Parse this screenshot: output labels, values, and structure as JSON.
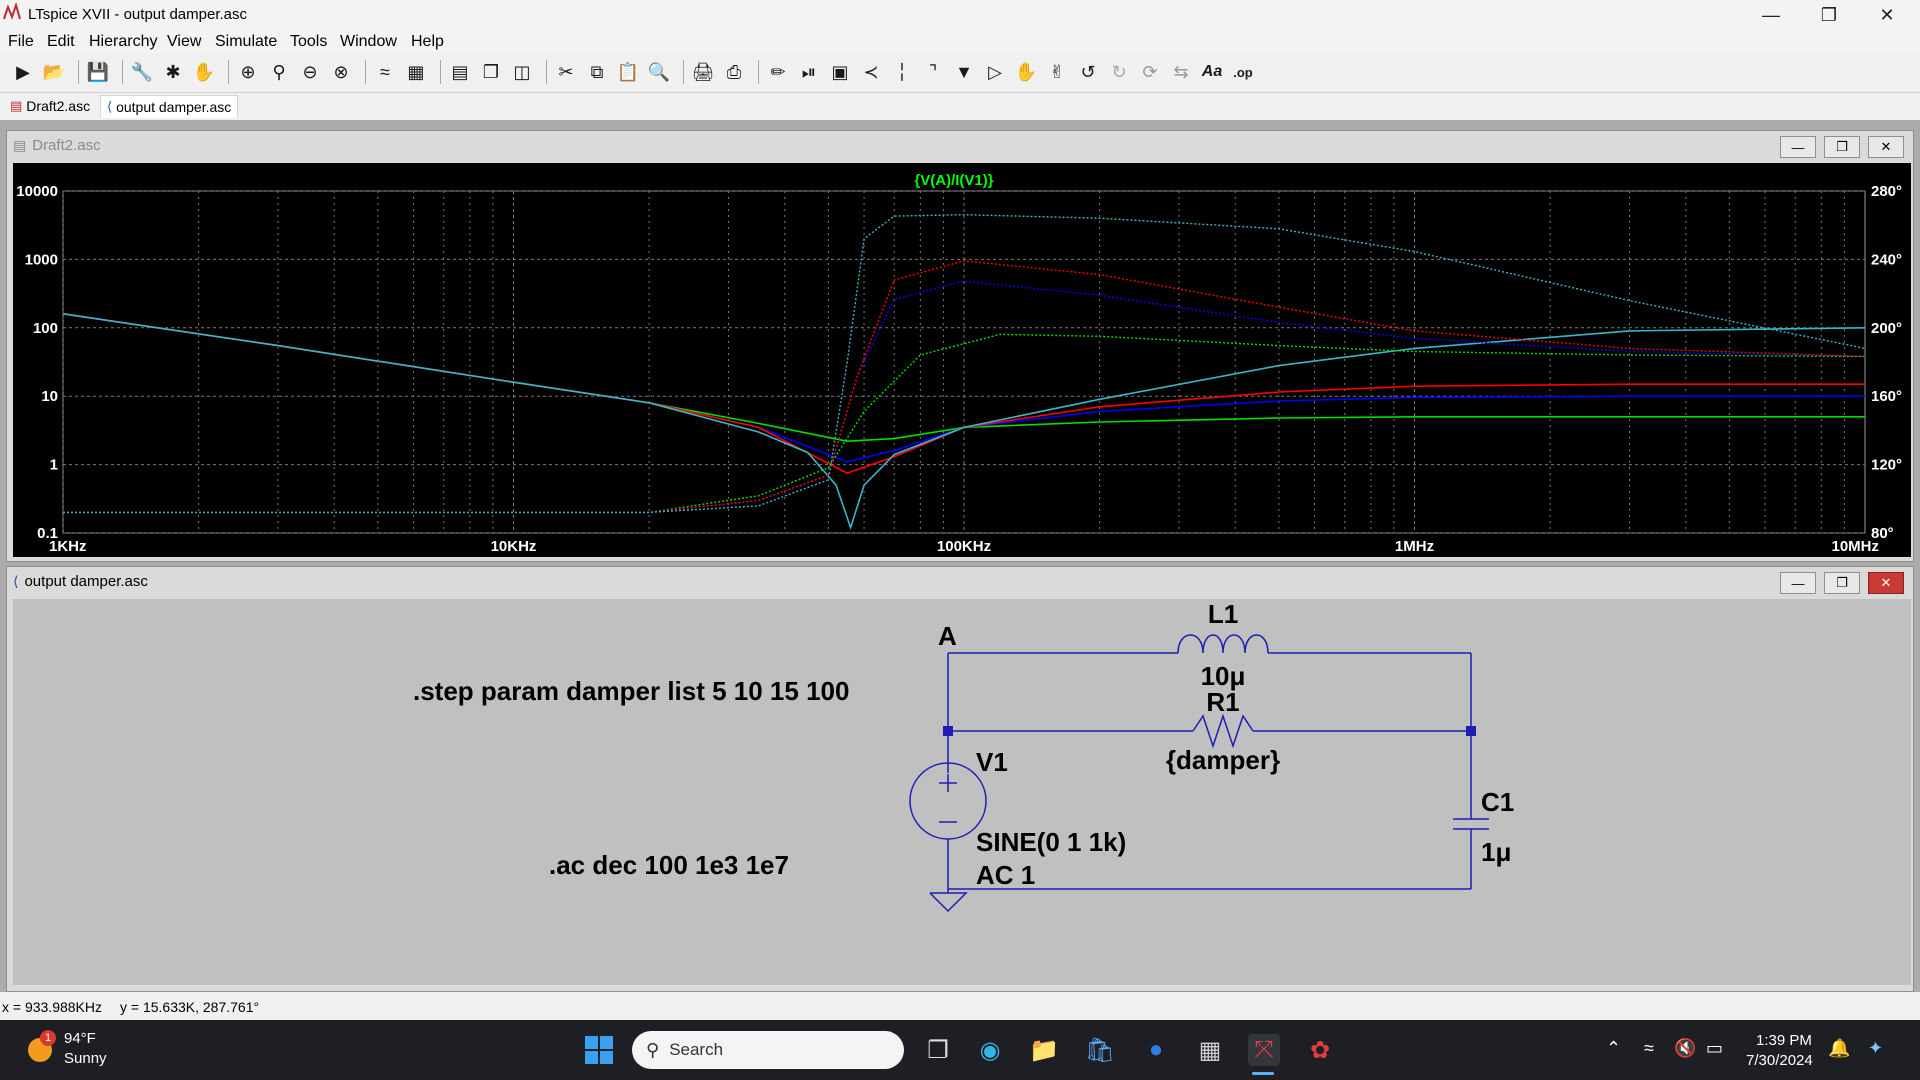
{
  "window": {
    "title": "LTspice XVII - output damper.asc",
    "minimize_icon": "minimize-icon",
    "maximize_icon": "restore-icon",
    "close_icon": "close-icon"
  },
  "menu": [
    "File",
    "Edit",
    "Hierarchy",
    "View",
    "Simulate",
    "Tools",
    "Window",
    "Help"
  ],
  "toolbar": {
    "icons": [
      "run-icon",
      "open-icon",
      "save-icon",
      "control-panel-icon",
      "halt-icon",
      "pan-icon",
      "zoom-in-icon",
      "zoom-area-icon",
      "zoom-out-icon",
      "zoom-fit-icon",
      "autorange-icon",
      "grid-icon",
      "tile-horizontal-icon",
      "cascade-icon",
      "tile-vertical-icon",
      "cut-icon",
      "copy-icon",
      "paste-icon",
      "find-icon",
      "print-icon",
      "print-setup-icon",
      "draw-wire-icon",
      "ground-icon",
      "label-net-icon",
      "resistor-icon",
      "capacitor-icon",
      "inductor-icon",
      "diode-icon",
      "component-icon",
      "move-icon",
      "drag-icon",
      "undo-icon",
      "redo-icon",
      "rotate-icon",
      "mirror-icon",
      "text-icon",
      "spice-directive-icon"
    ],
    "text_button": "Aa",
    "op_button": ".op"
  },
  "tabs": [
    {
      "label": "Draft2.asc",
      "icon": "waveform-icon",
      "active": false
    },
    {
      "label": "output damper.asc",
      "icon": "schematic-icon",
      "active": true
    }
  ],
  "plot_window": {
    "title": "Draft2.asc",
    "trace_expression": "{V(A)/I(V1)}",
    "trace_color": "#00ff00"
  },
  "chart_data": {
    "type": "line",
    "title": "{V(A)/I(V1)}",
    "xlabel": "",
    "ylabel": "",
    "x_scale": "log",
    "y_scale": "log",
    "xlim": [
      1000,
      10000000
    ],
    "ylim": [
      0.1,
      10000
    ],
    "y2lim": [
      80,
      280
    ],
    "x_tick_labels": [
      "1KHz",
      "10KHz",
      "100KHz",
      "1MHz",
      "10MHz"
    ],
    "y_tick_labels": [
      "10000",
      "1000",
      "100",
      "10",
      "1",
      "0.1"
    ],
    "y2_tick_labels": [
      "280°",
      "240°",
      "200°",
      "160°",
      "120°",
      "80°"
    ],
    "grid": true,
    "series": [
      {
        "color": "#00e000",
        "style": "solid",
        "x": [
          1000,
          3000,
          10000,
          20000,
          35000,
          55000,
          70000,
          100000,
          200000,
          500000,
          1000000,
          3000000,
          10000000
        ],
        "y": [
          160,
          55,
          16,
          8,
          4,
          2.2,
          2.4,
          3.5,
          4.2,
          4.8,
          5,
          5,
          5
        ]
      },
      {
        "color": "#0000ff",
        "style": "solid",
        "x": [
          1000,
          3000,
          10000,
          20000,
          35000,
          55000,
          70000,
          100000,
          200000,
          500000,
          1000000,
          3000000,
          10000000
        ],
        "y": [
          160,
          55,
          16,
          8,
          3.5,
          1.1,
          1.6,
          3.5,
          6,
          8.5,
          9.6,
          10,
          10
        ]
      },
      {
        "color": "#ff0000",
        "style": "solid",
        "x": [
          1000,
          3000,
          10000,
          20000,
          35000,
          55000,
          70000,
          100000,
          200000,
          500000,
          1000000,
          3000000,
          10000000
        ],
        "y": [
          160,
          55,
          16,
          8,
          3.5,
          0.75,
          1.3,
          3.5,
          7,
          11.5,
          14,
          15,
          15
        ]
      },
      {
        "color": "#3ab6c8",
        "style": "solid",
        "x": [
          1000,
          3000,
          10000,
          20000,
          35000,
          45000,
          52000,
          56000,
          60000,
          70000,
          100000,
          200000,
          500000,
          1000000,
          3000000,
          10000000
        ],
        "y": [
          160,
          55,
          16,
          8,
          3,
          1.5,
          0.5,
          0.12,
          0.5,
          1.4,
          3.5,
          9,
          28,
          50,
          90,
          100
        ]
      },
      {
        "color": "#00e000",
        "style": "dotted",
        "x": [
          1000,
          10000,
          20000,
          35000,
          50000,
          60000,
          80000,
          120000,
          200000,
          500000,
          1000000,
          3000000,
          10000000
        ],
        "y": [
          0.2,
          0.2,
          0.2,
          0.35,
          0.9,
          6,
          40,
          80,
          75,
          55,
          45,
          40,
          38
        ]
      },
      {
        "color": "#0000ff",
        "style": "dotted",
        "x": [
          1000,
          10000,
          20000,
          35000,
          50000,
          58000,
          70000,
          100000,
          200000,
          500000,
          1000000,
          3000000,
          10000000
        ],
        "y": [
          0.2,
          0.2,
          0.2,
          0.3,
          0.7,
          20,
          260,
          480,
          300,
          120,
          70,
          45,
          38
        ]
      },
      {
        "color": "#ff0000",
        "style": "dotted",
        "x": [
          1000,
          10000,
          20000,
          35000,
          50000,
          58000,
          70000,
          100000,
          200000,
          500000,
          1000000,
          3000000,
          10000000
        ],
        "y": [
          0.2,
          0.2,
          0.2,
          0.3,
          0.7,
          20,
          500,
          950,
          600,
          200,
          90,
          50,
          38
        ]
      },
      {
        "color": "#3ab6c8",
        "style": "dotted",
        "x": [
          1000,
          10000,
          20000,
          35000,
          50000,
          55000,
          60000,
          70000,
          100000,
          200000,
          500000,
          1000000,
          3000000,
          10000000
        ],
        "y": [
          0.2,
          0.2,
          0.2,
          0.25,
          0.6,
          30,
          2000,
          4300,
          4500,
          4000,
          2800,
          1300,
          250,
          50
        ]
      }
    ]
  },
  "schematic_window": {
    "title": "output damper.asc",
    "net_label": "A",
    "inductor": {
      "name": "L1",
      "value": "10μ"
    },
    "resistor": {
      "name": "R1",
      "value": "{damper}"
    },
    "source": {
      "name": "V1",
      "line1": "SINE(0 1 1k)",
      "line2": "AC 1"
    },
    "capacitor": {
      "name": "C1",
      "value": "1μ"
    },
    "directive_step": ".step param damper list 5 10 15 100",
    "directive_ac": ".ac dec 100 1e3 1e7",
    "wire_color": "#1e1eb4",
    "component_color": "#1e1eb4"
  },
  "status": {
    "x_readout": "x = 933.988KHz",
    "y_readout": "y = 15.633K, 287.761°"
  },
  "taskbar": {
    "weather_temp": "94°F",
    "weather_cond": "Sunny",
    "weather_badge": "1",
    "search_placeholder": "Search",
    "time": "1:39 PM",
    "date": "7/30/2024"
  }
}
